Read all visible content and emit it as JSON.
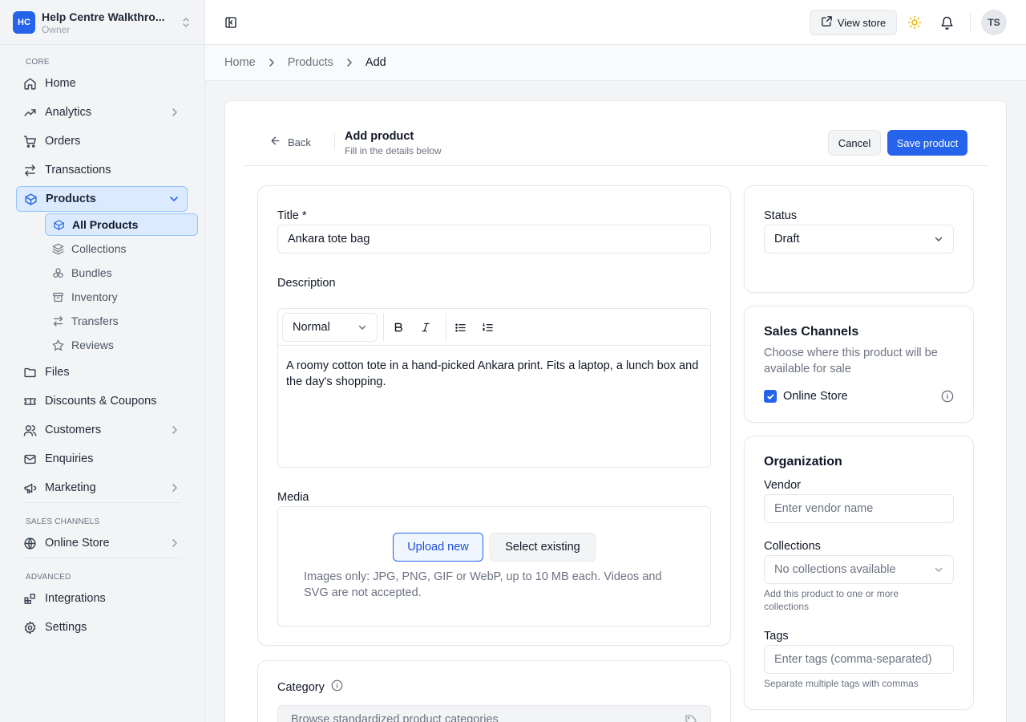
{
  "workspace": {
    "logo": "HC",
    "name": "Help Centre Walkthro...",
    "role": "Owner"
  },
  "sidebar": {
    "sections": {
      "core": "CORE",
      "sales_channels": "SALES CHANNELS",
      "advanced": "ADVANCED"
    },
    "items": {
      "home": "Home",
      "analytics": "Analytics",
      "orders": "Orders",
      "transactions": "Transactions",
      "products": "Products",
      "files": "Files",
      "discounts": "Discounts & Coupons",
      "customers": "Customers",
      "enquiries": "Enquiries",
      "marketing": "Marketing",
      "online_store": "Online Store",
      "integrations": "Integrations",
      "settings": "Settings"
    },
    "products_sub": {
      "all_products": "All Products",
      "collections": "Collections",
      "bundles": "Bundles",
      "inventory": "Inventory",
      "transfers": "Transfers",
      "reviews": "Reviews"
    }
  },
  "topbar": {
    "view_store": "View store",
    "avatar": "TS"
  },
  "breadcrumb": [
    "Home",
    "Products",
    "Add"
  ],
  "form_header": {
    "back": "Back",
    "title": "Add product",
    "subtitle": "Fill in the details below",
    "cancel": "Cancel",
    "save": "Save product"
  },
  "main": {
    "title_label": "Title *",
    "title_value": "Ankara tote bag",
    "description_label": "Description",
    "text_style": "Normal",
    "description_value": "A roomy cotton tote in a hand-picked Ankara print. Fits a laptop, a lunch box and the day's shopping.",
    "media_label": "Media",
    "upload_new": "Upload new",
    "select_existing": "Select existing",
    "media_hint": "Images only: JPG, PNG, GIF or WebP, up to 10 MB each. Videos and SVG are not accepted.",
    "category_label": "Category",
    "category_placeholder": "Browse standardized product categories"
  },
  "status": {
    "label": "Status",
    "value": "Draft"
  },
  "sales_channels": {
    "title": "Sales Channels",
    "description": "Choose where this product will be available for sale",
    "online_store": "Online Store",
    "online_store_checked": true
  },
  "organization": {
    "title": "Organization",
    "vendor_label": "Vendor",
    "vendor_placeholder": "Enter vendor name",
    "collections_label": "Collections",
    "collections_value": "No collections available",
    "collections_help": "Add this product to one or more collections",
    "tags_label": "Tags",
    "tags_placeholder": "Enter tags (comma-separated)",
    "tags_help": "Separate multiple tags with commas"
  },
  "colors": {
    "accent": "#2563eb",
    "active_bg": "#dbeafe",
    "sun": "#eab308"
  }
}
